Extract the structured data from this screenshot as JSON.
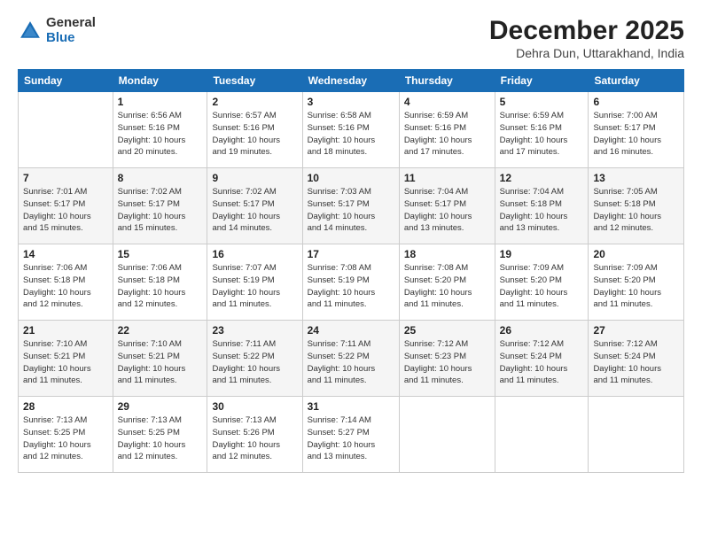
{
  "logo": {
    "general": "General",
    "blue": "Blue"
  },
  "header": {
    "month": "December 2025",
    "location": "Dehra Dun, Uttarakhand, India"
  },
  "weekdays": [
    "Sunday",
    "Monday",
    "Tuesday",
    "Wednesday",
    "Thursday",
    "Friday",
    "Saturday"
  ],
  "weeks": [
    [
      {
        "day": "",
        "info": ""
      },
      {
        "day": "1",
        "info": "Sunrise: 6:56 AM\nSunset: 5:16 PM\nDaylight: 10 hours\nand 20 minutes."
      },
      {
        "day": "2",
        "info": "Sunrise: 6:57 AM\nSunset: 5:16 PM\nDaylight: 10 hours\nand 19 minutes."
      },
      {
        "day": "3",
        "info": "Sunrise: 6:58 AM\nSunset: 5:16 PM\nDaylight: 10 hours\nand 18 minutes."
      },
      {
        "day": "4",
        "info": "Sunrise: 6:59 AM\nSunset: 5:16 PM\nDaylight: 10 hours\nand 17 minutes."
      },
      {
        "day": "5",
        "info": "Sunrise: 6:59 AM\nSunset: 5:16 PM\nDaylight: 10 hours\nand 17 minutes."
      },
      {
        "day": "6",
        "info": "Sunrise: 7:00 AM\nSunset: 5:17 PM\nDaylight: 10 hours\nand 16 minutes."
      }
    ],
    [
      {
        "day": "7",
        "info": "Sunrise: 7:01 AM\nSunset: 5:17 PM\nDaylight: 10 hours\nand 15 minutes."
      },
      {
        "day": "8",
        "info": "Sunrise: 7:02 AM\nSunset: 5:17 PM\nDaylight: 10 hours\nand 15 minutes."
      },
      {
        "day": "9",
        "info": "Sunrise: 7:02 AM\nSunset: 5:17 PM\nDaylight: 10 hours\nand 14 minutes."
      },
      {
        "day": "10",
        "info": "Sunrise: 7:03 AM\nSunset: 5:17 PM\nDaylight: 10 hours\nand 14 minutes."
      },
      {
        "day": "11",
        "info": "Sunrise: 7:04 AM\nSunset: 5:17 PM\nDaylight: 10 hours\nand 13 minutes."
      },
      {
        "day": "12",
        "info": "Sunrise: 7:04 AM\nSunset: 5:18 PM\nDaylight: 10 hours\nand 13 minutes."
      },
      {
        "day": "13",
        "info": "Sunrise: 7:05 AM\nSunset: 5:18 PM\nDaylight: 10 hours\nand 12 minutes."
      }
    ],
    [
      {
        "day": "14",
        "info": "Sunrise: 7:06 AM\nSunset: 5:18 PM\nDaylight: 10 hours\nand 12 minutes."
      },
      {
        "day": "15",
        "info": "Sunrise: 7:06 AM\nSunset: 5:18 PM\nDaylight: 10 hours\nand 12 minutes."
      },
      {
        "day": "16",
        "info": "Sunrise: 7:07 AM\nSunset: 5:19 PM\nDaylight: 10 hours\nand 11 minutes."
      },
      {
        "day": "17",
        "info": "Sunrise: 7:08 AM\nSunset: 5:19 PM\nDaylight: 10 hours\nand 11 minutes."
      },
      {
        "day": "18",
        "info": "Sunrise: 7:08 AM\nSunset: 5:20 PM\nDaylight: 10 hours\nand 11 minutes."
      },
      {
        "day": "19",
        "info": "Sunrise: 7:09 AM\nSunset: 5:20 PM\nDaylight: 10 hours\nand 11 minutes."
      },
      {
        "day": "20",
        "info": "Sunrise: 7:09 AM\nSunset: 5:20 PM\nDaylight: 10 hours\nand 11 minutes."
      }
    ],
    [
      {
        "day": "21",
        "info": "Sunrise: 7:10 AM\nSunset: 5:21 PM\nDaylight: 10 hours\nand 11 minutes."
      },
      {
        "day": "22",
        "info": "Sunrise: 7:10 AM\nSunset: 5:21 PM\nDaylight: 10 hours\nand 11 minutes."
      },
      {
        "day": "23",
        "info": "Sunrise: 7:11 AM\nSunset: 5:22 PM\nDaylight: 10 hours\nand 11 minutes."
      },
      {
        "day": "24",
        "info": "Sunrise: 7:11 AM\nSunset: 5:22 PM\nDaylight: 10 hours\nand 11 minutes."
      },
      {
        "day": "25",
        "info": "Sunrise: 7:12 AM\nSunset: 5:23 PM\nDaylight: 10 hours\nand 11 minutes."
      },
      {
        "day": "26",
        "info": "Sunrise: 7:12 AM\nSunset: 5:24 PM\nDaylight: 10 hours\nand 11 minutes."
      },
      {
        "day": "27",
        "info": "Sunrise: 7:12 AM\nSunset: 5:24 PM\nDaylight: 10 hours\nand 11 minutes."
      }
    ],
    [
      {
        "day": "28",
        "info": "Sunrise: 7:13 AM\nSunset: 5:25 PM\nDaylight: 10 hours\nand 12 minutes."
      },
      {
        "day": "29",
        "info": "Sunrise: 7:13 AM\nSunset: 5:25 PM\nDaylight: 10 hours\nand 12 minutes."
      },
      {
        "day": "30",
        "info": "Sunrise: 7:13 AM\nSunset: 5:26 PM\nDaylight: 10 hours\nand 12 minutes."
      },
      {
        "day": "31",
        "info": "Sunrise: 7:14 AM\nSunset: 5:27 PM\nDaylight: 10 hours\nand 13 minutes."
      },
      {
        "day": "",
        "info": ""
      },
      {
        "day": "",
        "info": ""
      },
      {
        "day": "",
        "info": ""
      }
    ]
  ]
}
